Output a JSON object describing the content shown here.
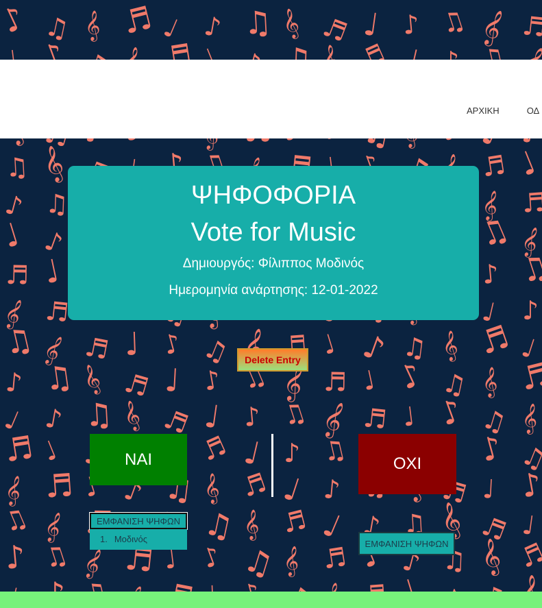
{
  "nav": {
    "items": [
      "ΑΡΧΙΚΗ",
      "ΟΔ"
    ]
  },
  "header": {
    "title_greek": "ΨΗΦΟΦΟΡΙΑ",
    "title_english": "Vote for Music",
    "creator": "Δημιουργός: Φίλιππος Μοδινός",
    "date": "Ημερομηνία ανάρτησης: 12-01-2022"
  },
  "actions": {
    "delete_label": "Delete Entry"
  },
  "vote": {
    "yes_label": "ΝΑΙ",
    "no_label": "ΟΧΙ",
    "show_votes_label": "ΕΜΦΑΝΙΣΗ ΨΗΦΩΝ",
    "yes_voters": [
      {
        "number": "1.",
        "name": "Μοδινός"
      }
    ]
  },
  "colors": {
    "background": "#0b2340",
    "pattern": "#f07a6a",
    "card": "#17aea9",
    "yes": "#008000",
    "no": "#8b0000",
    "footer": "#77f27b"
  },
  "icons": {
    "pattern_glyph": "music-note-icon"
  }
}
